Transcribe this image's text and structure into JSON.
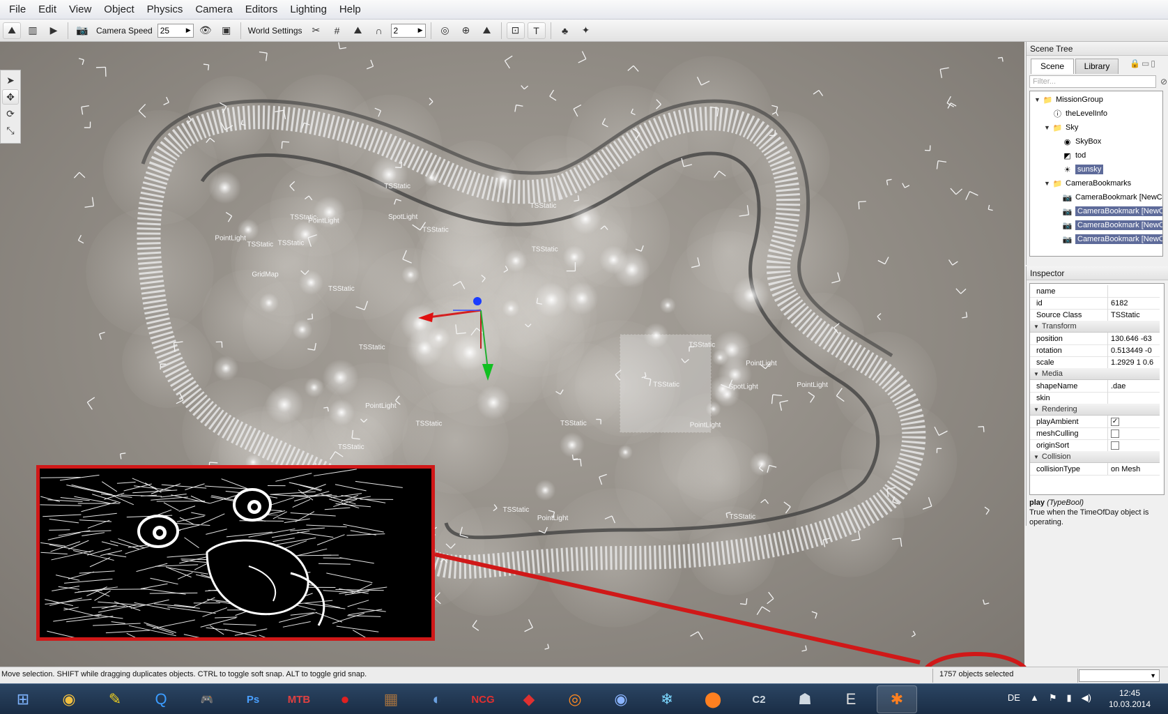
{
  "menu": [
    "File",
    "Edit",
    "View",
    "Object",
    "Physics",
    "Camera",
    "Editors",
    "Lighting",
    "Help"
  ],
  "toolbar": {
    "camera_speed_label": "Camera Speed",
    "camera_speed_value": "25",
    "world_settings_label": "World Settings",
    "grid_value": "2",
    "text_tool": "T"
  },
  "viewport": {
    "labels": [
      {
        "t": "TSStatic"
      },
      {
        "t": "TSStatic"
      },
      {
        "t": "PointLight"
      },
      {
        "t": "SpotLight"
      },
      {
        "t": "TSStatic"
      },
      {
        "t": "GridMap"
      },
      {
        "t": "PointLight"
      },
      {
        "t": "TSStatic"
      },
      {
        "t": "TSStatic"
      },
      {
        "t": "PointLight"
      },
      {
        "t": "SpotLight"
      },
      {
        "t": "PointLight"
      },
      {
        "t": "TSStatic"
      },
      {
        "t": "TSStatic"
      },
      {
        "t": "PointLight"
      },
      {
        "t": "TSStatic"
      },
      {
        "t": "PointLight"
      },
      {
        "t": "PointLight"
      },
      {
        "t": "TSStatic"
      },
      {
        "t": "PointLight"
      },
      {
        "t": "TSStatic"
      },
      {
        "t": "TSStatic"
      },
      {
        "t": "TSStatic"
      },
      {
        "t": "TSStatic"
      },
      {
        "t": "TSStatic"
      },
      {
        "t": "TSStatic"
      },
      {
        "t": "TSStatic"
      },
      {
        "t": "TSStatic"
      },
      {
        "t": "TSStatic"
      },
      {
        "t": "TSStatic"
      }
    ]
  },
  "scene_tree": {
    "title": "Scene Tree",
    "tabs": [
      "Scene",
      "Library"
    ],
    "filter_placeholder": "Filter...",
    "items": [
      {
        "label": "MissionGroup",
        "icon": "folder-icon",
        "selected": false
      },
      {
        "label": "theLevelInfo",
        "icon": "info-icon",
        "selected": false
      },
      {
        "label": "Sky",
        "icon": "folder-icon",
        "selected": false
      },
      {
        "label": "SkyBox",
        "icon": "skybox-icon",
        "selected": false
      },
      {
        "label": "tod",
        "icon": "tod-icon",
        "selected": false
      },
      {
        "label": "sunsky",
        "icon": "sun-icon",
        "selected": true
      },
      {
        "label": "CameraBookmarks",
        "icon": "folder-icon",
        "selected": false
      },
      {
        "label": "CameraBookmark [NewC",
        "icon": "camera-icon",
        "selected": false
      },
      {
        "label": "CameraBookmark [NewC",
        "icon": "camera-icon",
        "selected": true
      },
      {
        "label": "CameraBookmark [NewC",
        "icon": "camera-icon",
        "selected": true
      },
      {
        "label": "CameraBookmark [NewC",
        "icon": "camera-icon",
        "selected": true
      }
    ]
  },
  "inspector": {
    "title": "Inspector",
    "rows_top": [
      {
        "k": "name",
        "v": ""
      },
      {
        "k": "id",
        "v": "6182"
      },
      {
        "k": "Source Class",
        "v": "TSStatic"
      }
    ],
    "groups": {
      "transform": "Transform",
      "media": "Media",
      "rendering": "Rendering",
      "collision": "Collision"
    },
    "transform": [
      {
        "k": "position",
        "v": "130.646 -63"
      },
      {
        "k": "rotation",
        "v": "0.513449 -0"
      },
      {
        "k": "scale",
        "v": "1.2929 1 0.6"
      }
    ],
    "media": [
      {
        "k": "shapeName",
        "v": ".dae"
      },
      {
        "k": "skin",
        "v": ""
      }
    ],
    "rendering": [
      {
        "k": "playAmbient",
        "checked": true
      },
      {
        "k": "meshCulling",
        "checked": false
      },
      {
        "k": "originSort",
        "checked": false
      }
    ],
    "collision": [
      {
        "k": "collisionType",
        "v": "on Mesh"
      }
    ],
    "desc_name": "play",
    "desc_type": "(TypeBool)",
    "desc_text": "True when the TimeOfDay object is operating."
  },
  "status": {
    "hint": "Move selection.  SHIFT while dragging duplicates objects.  CTRL to toggle soft snap.  ALT to toggle grid snap.",
    "selected": "1757 objects selected"
  },
  "taskbar": {
    "apps": [
      {
        "name": "windows-start-icon",
        "glyph": "⊞"
      },
      {
        "name": "chrome-icon",
        "glyph": "◉"
      },
      {
        "name": "banana-icon",
        "glyph": "✎"
      },
      {
        "name": "quicktime-icon",
        "glyph": "Q"
      },
      {
        "name": "gamepad-icon",
        "glyph": "🎮"
      },
      {
        "name": "photoshop-icon",
        "glyph": "Ps"
      },
      {
        "name": "mtb-icon",
        "glyph": "MTB"
      },
      {
        "name": "record-icon",
        "glyph": "●"
      },
      {
        "name": "texture-icon",
        "glyph": "▦"
      },
      {
        "name": "globe-icon",
        "glyph": "◐"
      },
      {
        "name": "ncg-icon",
        "glyph": "NCG"
      },
      {
        "name": "sketchup-icon",
        "glyph": "◆"
      },
      {
        "name": "blender-icon",
        "glyph": "◎"
      },
      {
        "name": "eye-icon",
        "glyph": "◉"
      },
      {
        "name": "snowflake-icon",
        "glyph": "❄"
      },
      {
        "name": "nodes-icon",
        "glyph": "⬤"
      },
      {
        "name": "game-c2-icon",
        "glyph": "C2"
      },
      {
        "name": "robot-icon",
        "glyph": "☗"
      },
      {
        "name": "e-icon",
        "glyph": "E"
      },
      {
        "name": "torque-icon",
        "glyph": "✱"
      }
    ],
    "lang": "DE",
    "time": "12:45",
    "date": "10.03.2014"
  }
}
